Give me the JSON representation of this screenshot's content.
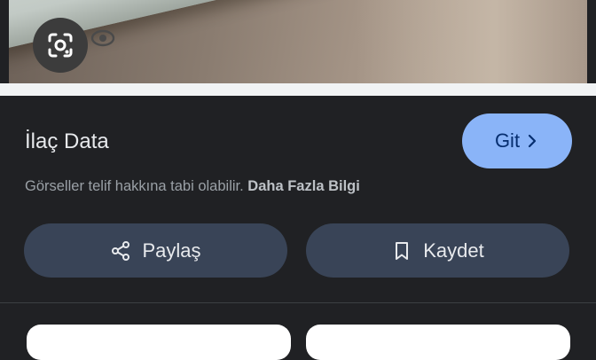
{
  "image_preview": {
    "box_print": "X",
    "lens_icon": "google-lens-icon",
    "secondary_icon": "eye-icon"
  },
  "source": {
    "title": "İlaç Data",
    "visit_label": "Git",
    "visit_icon": "chevron-right-icon"
  },
  "notice": {
    "text": "Görseller telif hakkına tabi olabilir. ",
    "link": "Daha Fazla Bilgi"
  },
  "actions": {
    "share_label": "Paylaş",
    "share_icon": "share-icon",
    "save_label": "Kaydet",
    "save_icon": "bookmark-icon"
  },
  "colors": {
    "background": "#202124",
    "visit_button": "#8ab4f8",
    "action_button": "#394457"
  }
}
